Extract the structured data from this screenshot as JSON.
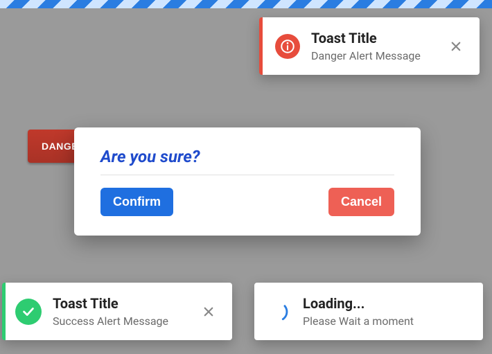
{
  "background_button": {
    "label": "DANGER"
  },
  "toast_danger": {
    "title": "Toast Title",
    "message": "Danger Alert Message"
  },
  "modal": {
    "title": "Are you sure?",
    "confirm_label": "Confirm",
    "cancel_label": "Cancel"
  },
  "toast_success": {
    "title": "Toast Title",
    "message": "Success Alert Message"
  },
  "toast_loading": {
    "title": "Loading...",
    "message": "Please Wait a moment"
  }
}
